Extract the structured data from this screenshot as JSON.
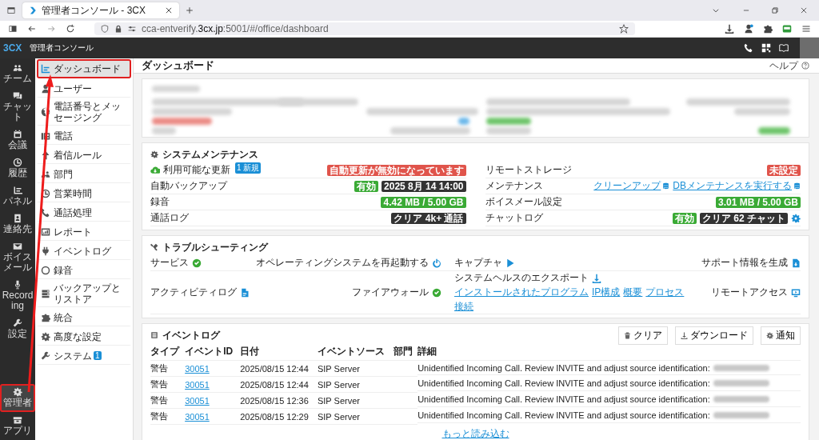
{
  "browser": {
    "tab_title": "管理者コンソール - 3CX",
    "url": "cca-entverify.**3cx.jp**:5001/#/office/dashboard"
  },
  "app_header": {
    "logo": "3CX",
    "title": "管理者コンソール"
  },
  "rail": {
    "items": [
      {
        "label": "チーム",
        "selected": false,
        "highlighted": false
      },
      {
        "label": "チャット",
        "selected": false,
        "highlighted": false
      },
      {
        "label": "会議",
        "selected": false,
        "highlighted": false
      },
      {
        "label": "履歴",
        "selected": false,
        "highlighted": false
      },
      {
        "label": "パネル",
        "selected": false,
        "highlighted": false
      },
      {
        "label": "連絡先",
        "selected": false,
        "highlighted": false
      },
      {
        "label": "ボイスメール",
        "selected": false,
        "highlighted": false
      },
      {
        "label": "Recording",
        "selected": false,
        "highlighted": false
      },
      {
        "label": "設定",
        "selected": false,
        "highlighted": false
      }
    ],
    "bottom_items": [
      {
        "label": "管理者",
        "selected": true,
        "highlighted": true
      },
      {
        "label": "アプリ",
        "selected": false,
        "highlighted": false
      }
    ]
  },
  "sidebar": {
    "items": [
      {
        "label": "ダッシュボード",
        "selected": true,
        "highlighted": true
      },
      {
        "label": "ユーザー",
        "selected": false,
        "highlighted": false
      },
      {
        "label": "電話番号とメッセージング",
        "selected": false,
        "highlighted": false
      },
      {
        "label": "電話",
        "selected": false,
        "highlighted": false
      },
      {
        "label": "着信ルール",
        "selected": false,
        "highlighted": false
      },
      {
        "label": "部門",
        "selected": false,
        "highlighted": false
      },
      {
        "label": "営業時間",
        "selected": false,
        "highlighted": false
      },
      {
        "label": "通話処理",
        "selected": false,
        "highlighted": false
      },
      {
        "label": "レポート",
        "selected": false,
        "highlighted": false
      },
      {
        "label": "イベントログ",
        "selected": false,
        "highlighted": false
      },
      {
        "label": "録音",
        "selected": false,
        "highlighted": false
      },
      {
        "label": "バックアップとリストア",
        "selected": false,
        "highlighted": false
      },
      {
        "label": "統合",
        "selected": false,
        "highlighted": false
      },
      {
        "label": "高度な設定",
        "selected": false,
        "highlighted": false
      },
      {
        "label": "システム",
        "selected": false,
        "highlighted": false,
        "badge": "1"
      }
    ]
  },
  "page": {
    "title": "ダッシュボード",
    "help": "ヘルプ"
  },
  "maintenance": {
    "title": "システムメンテナンス",
    "columns": [
      [
        {
          "label": "利用可能な更新",
          "kind": "update",
          "badge": "1 新規",
          "items": [
            {
              "kind": "badge",
              "text": "自動更新が無効になっています",
              "color": "#e0544b"
            }
          ]
        },
        {
          "label": "自動バックアップ",
          "kind": "plain",
          "items": [
            {
              "kind": "badge",
              "text": "有効",
              "color": "#3aaa35"
            },
            {
              "kind": "badge",
              "text": "2025 8月 14 14:00",
              "color": "#333333"
            }
          ]
        },
        {
          "label": "録音",
          "kind": "plain",
          "items": [
            {
              "kind": "badge",
              "text": "4.42 MB / 5.00 GB",
              "color": "#3aaa35"
            }
          ]
        },
        {
          "label": "通話ログ",
          "kind": "plain",
          "items": [
            {
              "kind": "badge",
              "text": "クリア 4k+ 通話",
              "color": "#333333"
            }
          ]
        }
      ],
      [
        {
          "label": "リモートストレージ",
          "kind": "plain",
          "items": [
            {
              "kind": "badge",
              "text": "未設定",
              "color": "#e0544b"
            }
          ]
        },
        {
          "label": "メンテナンス",
          "kind": "plain",
          "items": [
            {
              "kind": "link",
              "text": "クリーンアップ"
            },
            {
              "kind": "link",
              "text": "DBメンテナンスを実行する"
            }
          ]
        },
        {
          "label": "ボイスメール設定",
          "kind": "plain",
          "items": [
            {
              "kind": "badge",
              "text": "3.01 MB / 5.00 GB",
              "color": "#3aaa35"
            }
          ]
        },
        {
          "label": "チャットログ",
          "kind": "plain",
          "items": [
            {
              "kind": "badge",
              "text": "有効",
              "color": "#3aaa35"
            },
            {
              "kind": "badge",
              "text": "クリア 62 チャット",
              "color": "#333333"
            },
            {
              "kind": "gear"
            }
          ]
        }
      ]
    ]
  },
  "troubleshooting": {
    "title": "トラブルシューティング",
    "rows": [
      [
        {
          "label": "サービス",
          "kind": "status",
          "ok": true
        },
        {
          "label": "オペレーティングシステムを再起動する",
          "kind": "power"
        },
        {
          "label": "キャプチャ",
          "kind": "play"
        },
        {
          "label": "サポート情報を生成",
          "kind": "doc-download"
        }
      ],
      [
        {
          "label": "アクティビティログ",
          "kind": "doc"
        },
        {
          "label": "ファイアウォール",
          "kind": "status",
          "ok": true
        },
        {
          "label": "システムヘルスのエクスポート",
          "kind": "download",
          "links": [
            "インストールされたプログラム",
            "IP構成",
            "概要",
            "プロセス",
            "接続"
          ]
        },
        {
          "label": "リモートアクセス",
          "kind": "remote"
        }
      ]
    ]
  },
  "event_log": {
    "title": "イベントログ",
    "buttons": [
      "クリア",
      "ダウンロード",
      "通知"
    ],
    "columns": [
      "タイプ",
      "イベントID",
      "日付",
      "イベントソース",
      "部門",
      "詳細"
    ],
    "rows": [
      {
        "type": "警告",
        "id": "30051",
        "date": "2025/08/15 12:44",
        "source": "SIP Server",
        "detail": "Unidentified Incoming Call. Review INVITE and adjust source identification:",
        "redacted": true
      },
      {
        "type": "警告",
        "id": "30051",
        "date": "2025/08/15 12:44",
        "source": "SIP Server",
        "detail": "Unidentified Incoming Call. Review INVITE and adjust source identification:",
        "redacted": true
      },
      {
        "type": "警告",
        "id": "30051",
        "date": "2025/08/15 12:36",
        "source": "SIP Server",
        "detail": "Unidentified Incoming Call. Review INVITE and adjust source identification:",
        "redacted": true
      },
      {
        "type": "警告",
        "id": "30051",
        "date": "2025/08/15 12:29",
        "source": "SIP Server",
        "detail": "Unidentified Incoming Call. Review INVITE and adjust source identification:",
        "redacted": true
      }
    ],
    "load_more": "もっと読み込む"
  }
}
